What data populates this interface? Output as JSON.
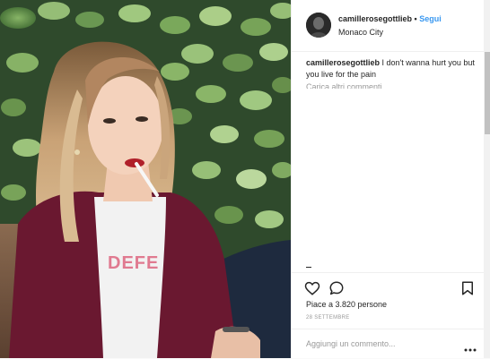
{
  "post": {
    "username": "camillerosegottlieb",
    "separator": "•",
    "follow_label": "Segui",
    "location": "Monaco City",
    "caption_user": "camillerosegottlieb",
    "caption_text": "I don't wanna hurt you but you live for the pain",
    "load_more_comments": "Carica altri commenti",
    "likes": "Piace a 3.820 persone",
    "date": "28 SETTEMBRE",
    "comment_placeholder": "Aggiungi un commento..."
  },
  "icons": {
    "like": "heart-icon",
    "comment": "comment-icon",
    "save": "bookmark-icon",
    "options": "more-options-icon"
  },
  "colors": {
    "follow": "#3897f0",
    "text": "#262626",
    "muted": "#999999",
    "border": "#efefef"
  }
}
